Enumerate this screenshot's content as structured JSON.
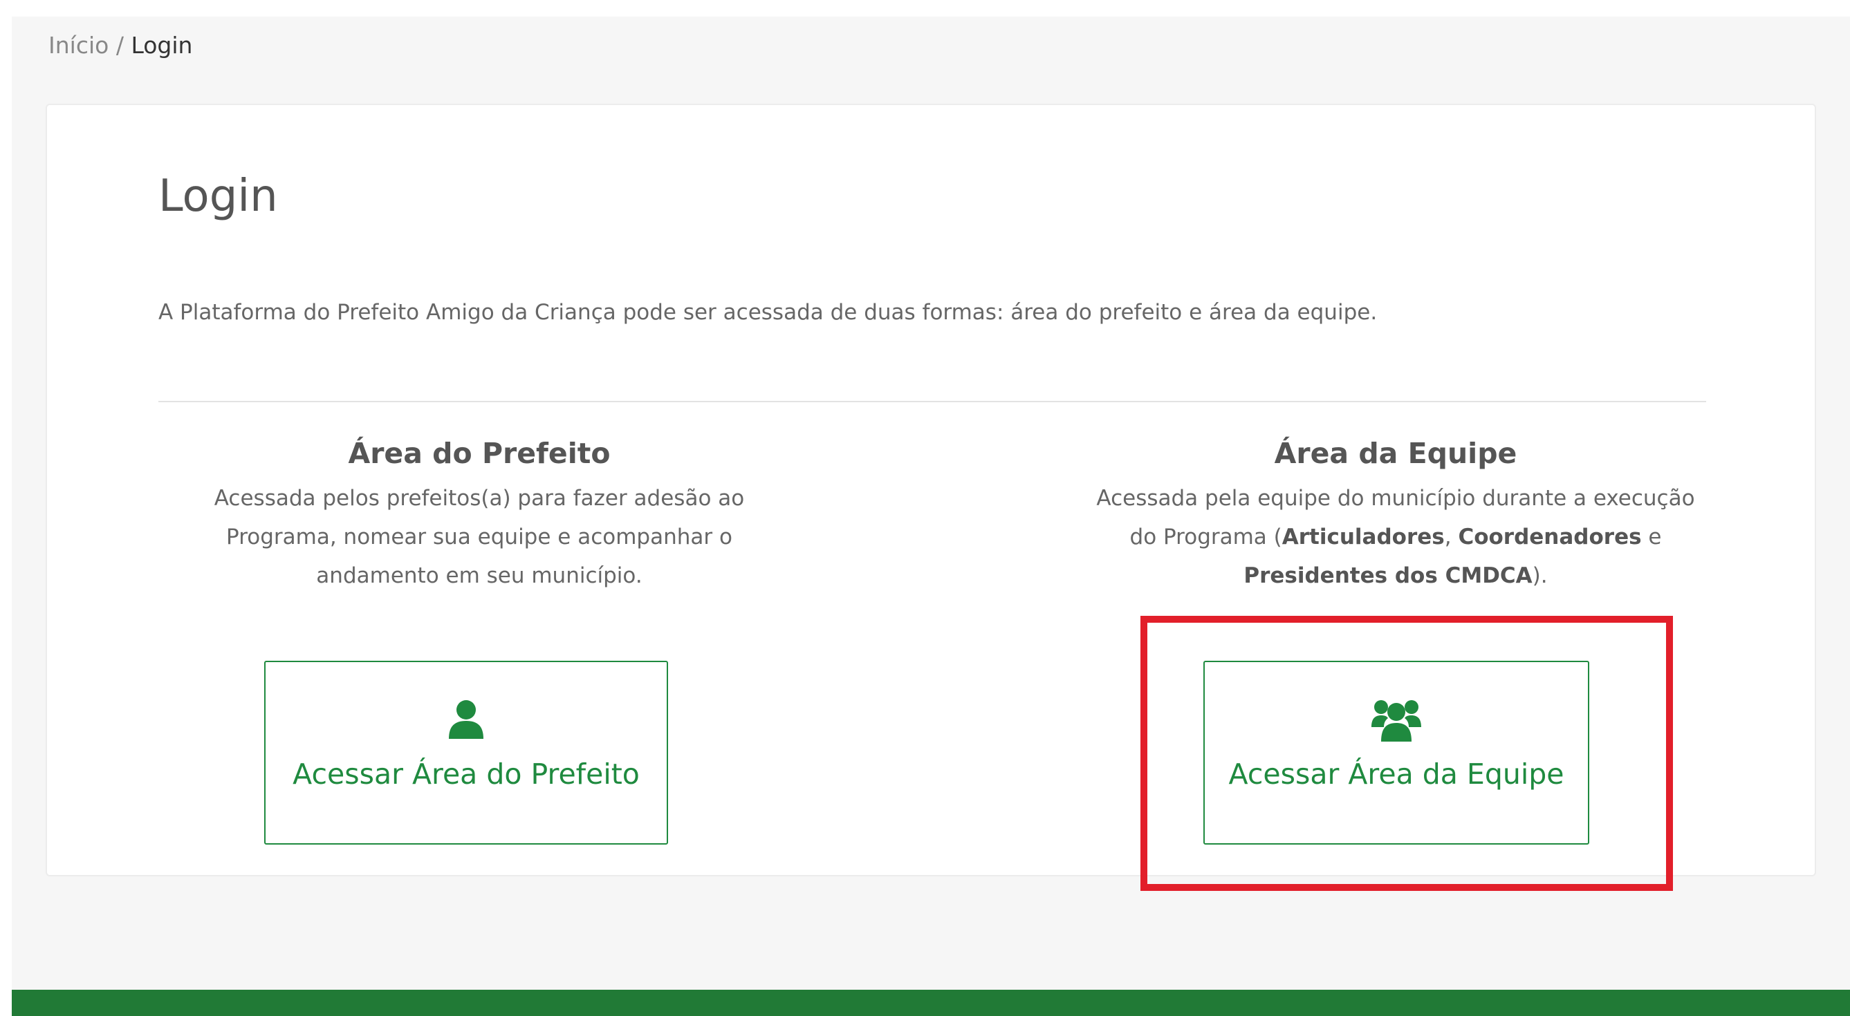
{
  "breadcrumb": {
    "home": "Início",
    "separator": " / ",
    "current": "Login"
  },
  "login": {
    "title": "Login",
    "intro": "A Plataforma do Prefeito Amigo da Criança pode ser acessada de duas formas: área do prefeito e área da equipe."
  },
  "prefeito": {
    "title": "Área do Prefeito",
    "description": "Acessada pelos prefeitos(a) para fazer adesão ao Programa, nomear sua equipe e acompanhar o andamento em seu município.",
    "button_label": "Acessar Área do Prefeito",
    "icon": "user-icon"
  },
  "equipe": {
    "title": "Área da Equipe",
    "description_before": "Acessada pela equipe do município durante a execução do Programa (",
    "role_1": "Articuladores",
    "sep_1": ", ",
    "role_2": "Coordenadores",
    "sep_2": " e ",
    "role_3": "Presidentes dos CMDCA",
    "description_after": ").",
    "button_label": "Acessar Área da Equipe",
    "icon": "users-icon"
  },
  "colors": {
    "brand_green": "#1f8a3f",
    "footer_green": "#217a36",
    "highlight_red": "#e21f2a"
  }
}
